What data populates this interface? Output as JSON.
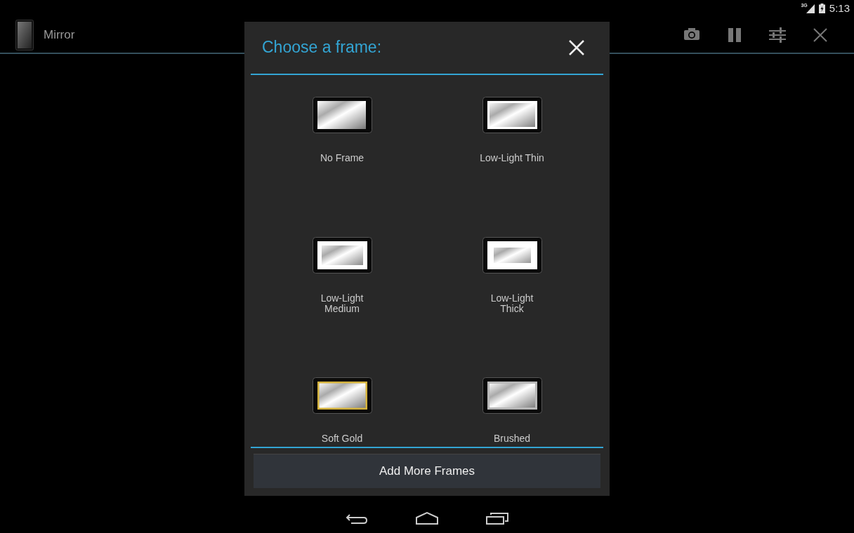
{
  "status_bar": {
    "network": "3G",
    "time": "5:13"
  },
  "action_bar": {
    "title": "Mirror"
  },
  "dialog": {
    "title": "Choose a frame:",
    "frames": [
      {
        "label": "No Frame",
        "kind": "none"
      },
      {
        "label": "Low-Light Thin",
        "kind": "thin"
      },
      {
        "label": "Low-Light\nMedium",
        "kind": "medium"
      },
      {
        "label": "Low-Light\nThick",
        "kind": "thick"
      },
      {
        "label": "Soft Gold",
        "kind": "gold"
      },
      {
        "label": "Brushed",
        "kind": "brushed"
      }
    ],
    "button": "Add More Frames"
  }
}
